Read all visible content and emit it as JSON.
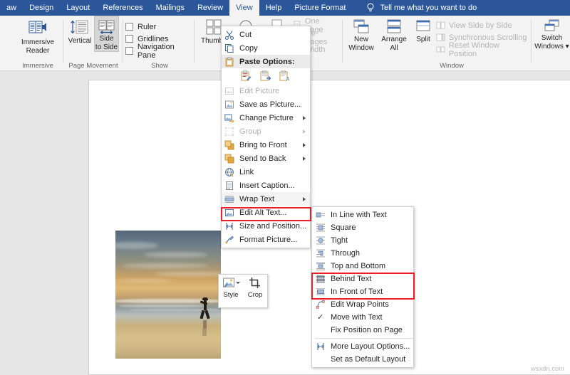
{
  "app": {
    "tabs": [
      {
        "label": "aw",
        "active": false
      },
      {
        "label": "Design",
        "active": false
      },
      {
        "label": "Layout",
        "active": false
      },
      {
        "label": "References",
        "active": false
      },
      {
        "label": "Mailings",
        "active": false
      },
      {
        "label": "Review",
        "active": false
      },
      {
        "label": "View",
        "active": true
      },
      {
        "label": "Help",
        "active": false
      },
      {
        "label": "Picture Format",
        "active": false
      }
    ],
    "tell_me": "Tell me what you want to do",
    "tell_me_icon": "lightbulb-icon",
    "accent_color": "#2b579a",
    "highlight_color": "#ee1c25"
  },
  "ribbon": {
    "groups": [
      {
        "name": "Immersive",
        "label": "Immersive",
        "buttons": [
          {
            "label_line1": "Immersive",
            "label_line2": "Reader",
            "icon": "immersive-reader-icon"
          }
        ]
      },
      {
        "name": "Page Movement",
        "label": "Page Movement",
        "buttons": [
          {
            "label_line1": "Vertical",
            "label_line2": "",
            "icon": "vertical-page-icon",
            "selected": false
          },
          {
            "label_line1": "Side",
            "label_line2": "to Side",
            "icon": "side-to-side-icon",
            "selected": true
          }
        ]
      },
      {
        "name": "Show",
        "label": "Show",
        "checkboxes": [
          {
            "label": "Ruler",
            "checked": false
          },
          {
            "label": "Gridlines",
            "checked": false
          },
          {
            "label": "Navigation Pane",
            "checked": false
          }
        ]
      },
      {
        "name": "Zoom",
        "label": "",
        "buttons": [
          {
            "label_line1": "Thumbn",
            "label_line2": "",
            "icon": "thumbnails-icon"
          }
        ],
        "items": [
          {
            "label": "One Page",
            "icon": "one-page-icon",
            "disabled": true
          },
          {
            "label": "ple Pages",
            "icon": "multiple-pages-icon",
            "disabled": true
          },
          {
            "label": "Width",
            "icon": "page-width-icon",
            "disabled": true
          }
        ]
      },
      {
        "name": "Window",
        "label": "Window",
        "buttons": [
          {
            "label_line1": "New",
            "label_line2": "Window",
            "icon": "new-window-icon"
          },
          {
            "label_line1": "Arrange",
            "label_line2": "All",
            "icon": "arrange-all-icon"
          },
          {
            "label_line1": "Split",
            "label_line2": "",
            "icon": "split-icon"
          },
          {
            "label_line1": "Switch",
            "label_line2": "Windows",
            "icon": "switch-windows-icon",
            "dropdown": true
          }
        ],
        "items": [
          {
            "label": "View Side by Side",
            "icon": "view-side-by-side-icon",
            "disabled": true
          },
          {
            "label": "Synchronous Scrolling",
            "icon": "synchronous-scrolling-icon",
            "disabled": true
          },
          {
            "label": "Reset Window Position",
            "icon": "reset-window-position-icon",
            "disabled": true
          }
        ]
      }
    ]
  },
  "context_menu": {
    "items": [
      {
        "label": "Cut",
        "icon": "scissors-icon",
        "disabled": false,
        "submenu": false
      },
      {
        "label": "Copy",
        "icon": "copy-icon",
        "disabled": false,
        "submenu": false
      },
      {
        "label": "Paste Options:",
        "icon": "clipboard-icon",
        "header": true
      },
      {
        "label": "Edit Picture",
        "icon": "edit-picture-icon",
        "disabled": true,
        "submenu": false
      },
      {
        "label": "Save as Picture...",
        "icon": "save-as-picture-icon",
        "disabled": false,
        "submenu": false
      },
      {
        "label": "Change Picture",
        "icon": "change-picture-icon",
        "disabled": false,
        "submenu": true
      },
      {
        "label": "Group",
        "icon": "group-icon",
        "disabled": true,
        "submenu": true
      },
      {
        "label": "Bring to Front",
        "icon": "bring-to-front-icon",
        "disabled": false,
        "submenu": true
      },
      {
        "label": "Send to Back",
        "icon": "send-to-back-icon",
        "disabled": false,
        "submenu": true
      },
      {
        "label": "Link",
        "icon": "link-icon",
        "disabled": false,
        "submenu": false
      },
      {
        "label": "Insert Caption...",
        "icon": "insert-caption-icon",
        "disabled": false,
        "submenu": false
      },
      {
        "label": "Wrap Text",
        "icon": "wrap-text-icon",
        "disabled": false,
        "submenu": true,
        "highlighted": true
      },
      {
        "label": "Edit Alt Text...",
        "icon": "edit-alt-text-icon",
        "disabled": false,
        "submenu": false
      },
      {
        "label": "Size and Position...",
        "icon": "size-and-position-icon",
        "disabled": false,
        "submenu": false
      },
      {
        "label": "Format Picture...",
        "icon": "format-picture-icon",
        "disabled": false,
        "submenu": false
      }
    ],
    "paste_icons": [
      "paste-keep-source-formatting-icon",
      "paste-merge-formatting-icon",
      "paste-keep-text-only-icon"
    ]
  },
  "wrap_submenu": {
    "items": [
      {
        "label": "In Line with Text",
        "icon": "wrap-inline-icon",
        "checked": false,
        "highlighted": false
      },
      {
        "label": "Square",
        "icon": "wrap-square-icon",
        "checked": false,
        "highlighted": false
      },
      {
        "label": "Tight",
        "icon": "wrap-tight-icon",
        "checked": false,
        "highlighted": false
      },
      {
        "label": "Through",
        "icon": "wrap-through-icon",
        "checked": false,
        "highlighted": false
      },
      {
        "label": "Top and Bottom",
        "icon": "wrap-top-bottom-icon",
        "checked": false,
        "highlighted": false
      },
      {
        "label": "Behind Text",
        "icon": "wrap-behind-text-icon",
        "checked": false,
        "highlighted": true
      },
      {
        "label": "In Front of Text",
        "icon": "wrap-in-front-of-text-icon",
        "checked": false,
        "highlighted": true
      },
      {
        "label": "Edit Wrap Points",
        "icon": "edit-wrap-points-icon",
        "checked": false,
        "highlighted": false
      },
      {
        "label": "Move with Text",
        "icon": "checkmark-icon",
        "checked": true,
        "highlighted": false
      },
      {
        "label": "Fix Position on Page",
        "icon": "",
        "checked": false,
        "highlighted": false
      },
      {
        "label": "More Layout Options...",
        "icon": "more-layout-options-icon",
        "checked": false,
        "highlighted": false
      },
      {
        "label": "Set as Default Layout",
        "icon": "",
        "checked": false,
        "highlighted": false
      }
    ]
  },
  "mini_toolbar": {
    "style_label": "Style",
    "crop_label": "Crop",
    "style_icon": "picture-style-icon",
    "crop_icon": "crop-icon"
  },
  "document": {
    "image_alt": "beach-sunset-silhouette-photo",
    "layout_options_icon": "layout-options-icon"
  },
  "watermark": "wsxdn.com"
}
